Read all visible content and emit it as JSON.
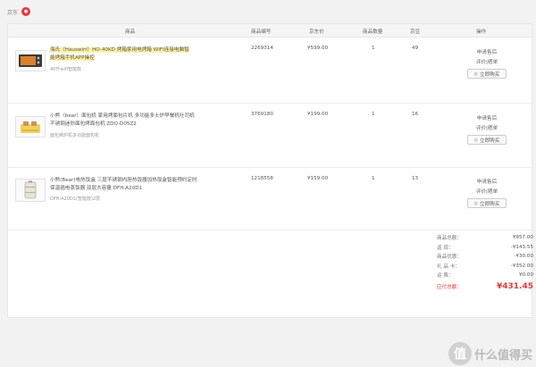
{
  "shop": {
    "label": "京东",
    "icon": "jd-logo-icon"
  },
  "table": {
    "headers": {
      "product": "商品",
      "sku": "商品编号",
      "price": "京东价",
      "qty": "商品数量",
      "beans": "京豆",
      "ops": "操作"
    }
  },
  "items": [
    {
      "name_hl": "海氏（Hauswirt）HO-40KD 烤箱家用电烤箱 WIFI连接电脑智",
      "name_hl2": "能烤箱手机APP操控",
      "note": "40升wifi智能款",
      "sku": "2269314",
      "price": "¥599.00",
      "qty": "1",
      "beans": "49",
      "op1": "申请售后",
      "op2": "评价|晒单",
      "buy": "立即购买",
      "thumb_icon": "oven-icon"
    },
    {
      "name1": "小熊（bear）面包机 家用烤面包片机 多功能多士炉早餐机吐司机",
      "name2": "不锈钢迷你面包烤面包机 ZDQ-D05Z2",
      "note": "面包烤炉机多功能面包机",
      "sku": "3769180",
      "price": "¥199.00",
      "qty": "1",
      "beans": "16",
      "op1": "申请售后",
      "op2": "评价|晒单",
      "buy": "立即购买",
      "thumb_icon": "toaster-icon"
    },
    {
      "name1": "小熊(Bear)电热饭盒 三层不锈钢内胆热饭器加热饭盒智能预约定时",
      "name2": "保温插电蒸饭器 双层大容量 DFH-A20D1",
      "note": "DFH-A20D1(智能款)2层",
      "sku": "1218558",
      "price": "¥159.00",
      "qty": "1",
      "beans": "13",
      "op1": "申请售后",
      "op2": "评价|晒单",
      "buy": "立即购买",
      "thumb_icon": "lunchbox-icon"
    }
  ],
  "summary": [
    {
      "label": "商品总额：",
      "value": "¥957.00"
    },
    {
      "label": "返      现：",
      "value": "-¥143.55"
    },
    {
      "label": "商品优惠：",
      "value": "-¥30.00"
    },
    {
      "label": "礼  品  卡：",
      "value": "-¥352.00"
    },
    {
      "label": "运      费：",
      "value": "¥0.00"
    }
  ],
  "total": {
    "label": "应付总额：",
    "value": "¥431.45"
  },
  "watermark": {
    "circle": "值",
    "text": "什么值得买"
  },
  "colors": {
    "accent": "#e4393c"
  }
}
